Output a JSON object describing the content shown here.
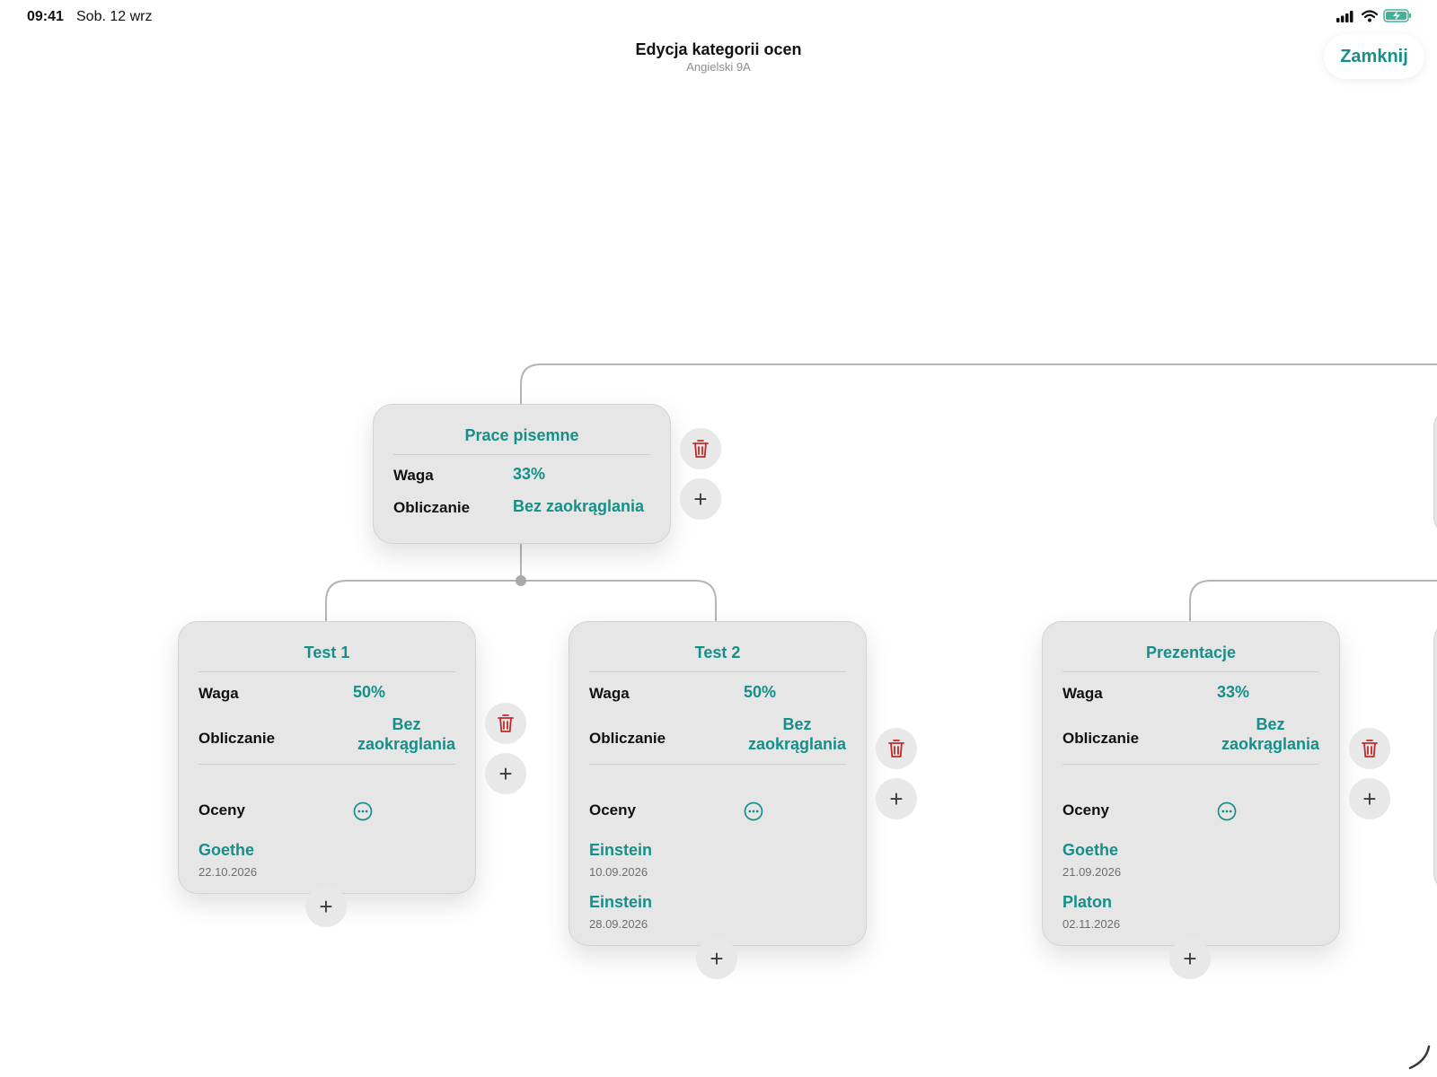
{
  "status_bar": {
    "time": "09:41",
    "date": "Sob. 12 wrz"
  },
  "nav": {
    "title": "Edycja kategorii ocen",
    "subtitle": "Angielski 9A",
    "close_label": "Zamknij"
  },
  "colors": {
    "accent": "#149089",
    "delete": "#c62828",
    "card_bg": "#e6e6e6"
  },
  "labels": {
    "weight": "Waga",
    "calculation": "Obliczanie",
    "grades": "Oceny"
  },
  "parent_category": {
    "title": "Prace pisemne",
    "weight": "33%",
    "calculation": "Bez zaokrąglania"
  },
  "categories": [
    {
      "title": "Test 1",
      "weight": "50%",
      "calc_line1": "Bez",
      "calc_line2": "zaokrąglania",
      "grades": [
        {
          "name": "Goethe",
          "date": "22.10.2026"
        }
      ]
    },
    {
      "title": "Test 2",
      "weight": "50%",
      "calc_line1": "Bez",
      "calc_line2": "zaokrąglania",
      "grades": [
        {
          "name": "Einstein",
          "date": "10.09.2026"
        },
        {
          "name": "Einstein",
          "date": "28.09.2026"
        }
      ]
    },
    {
      "title": "Prezentacje",
      "weight": "33%",
      "calc_line1": "Bez",
      "calc_line2": "zaokrąglania",
      "grades": [
        {
          "name": "Goethe",
          "date": "21.09.2026"
        },
        {
          "name": "Platon",
          "date": "02.11.2026"
        }
      ]
    }
  ],
  "icons": {
    "delete": "trash-icon",
    "add": "plus-icon",
    "more": "ellipsis-circle-icon"
  }
}
